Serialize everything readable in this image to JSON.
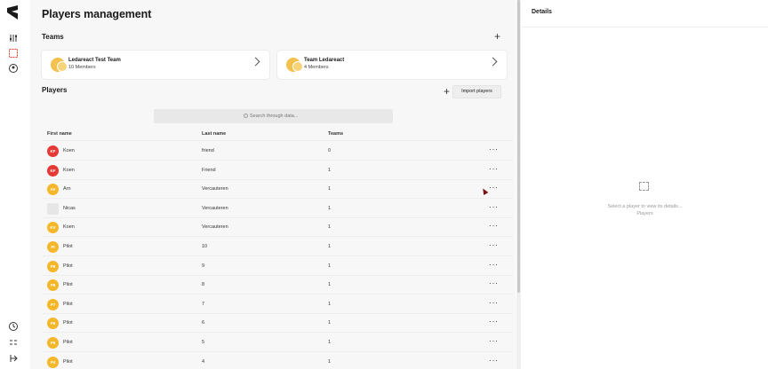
{
  "page": {
    "title": "Players management"
  },
  "colors": {
    "red_avatar": "#e53935",
    "yellow_avatar": "#f5b72a",
    "gray_avatar": "#e6e6e6"
  },
  "rail": {
    "top_icons": [
      "sliders-icon",
      "team-icon",
      "user-circle-icon"
    ],
    "bottom_icons": [
      "history-icon",
      "expand-icon",
      "logout-icon"
    ]
  },
  "teams": {
    "title": "Teams",
    "items": [
      {
        "name": "Ledareact Test Team",
        "members": "10 Members"
      },
      {
        "name": "Team Ledareact",
        "members": "4 Members"
      }
    ]
  },
  "players": {
    "title": "Players",
    "import_label": "Import players",
    "search_placeholder": "Search through data...",
    "columns": [
      "First name",
      "Last name",
      "Teams"
    ],
    "rows": [
      {
        "initials": "KF",
        "first": "Koen",
        "last": "friend",
        "teams": "0",
        "color": "red"
      },
      {
        "initials": "KF",
        "first": "Koen",
        "last": "Friend",
        "teams": "1",
        "color": "red"
      },
      {
        "initials": "AV",
        "first": "Arn",
        "last": "Vercauteren",
        "teams": "1",
        "color": "yellow"
      },
      {
        "initials": "",
        "first": "Nicas",
        "last": "Vercauteren",
        "teams": "1",
        "color": "gray"
      },
      {
        "initials": "KV",
        "first": "Koen",
        "last": "Vercauteren",
        "teams": "1",
        "color": "yellow"
      },
      {
        "initials": "PI",
        "first": "Pilot",
        "last": "10",
        "teams": "1",
        "color": "yellow"
      },
      {
        "initials": "P9",
        "first": "Pilot",
        "last": "9",
        "teams": "1",
        "color": "yellow"
      },
      {
        "initials": "P8",
        "first": "Pilot",
        "last": "8",
        "teams": "1",
        "color": "yellow"
      },
      {
        "initials": "P7",
        "first": "Pilot",
        "last": "7",
        "teams": "1",
        "color": "yellow"
      },
      {
        "initials": "P6",
        "first": "Pilot",
        "last": "6",
        "teams": "1",
        "color": "yellow"
      },
      {
        "initials": "P5",
        "first": "Pilot",
        "last": "5",
        "teams": "1",
        "color": "yellow"
      },
      {
        "initials": "P4",
        "first": "Pilot",
        "last": "4",
        "teams": "1",
        "color": "yellow"
      }
    ]
  },
  "details": {
    "title": "Details",
    "empty_line1": "Select a player to view its details...",
    "empty_line2": "Players"
  }
}
